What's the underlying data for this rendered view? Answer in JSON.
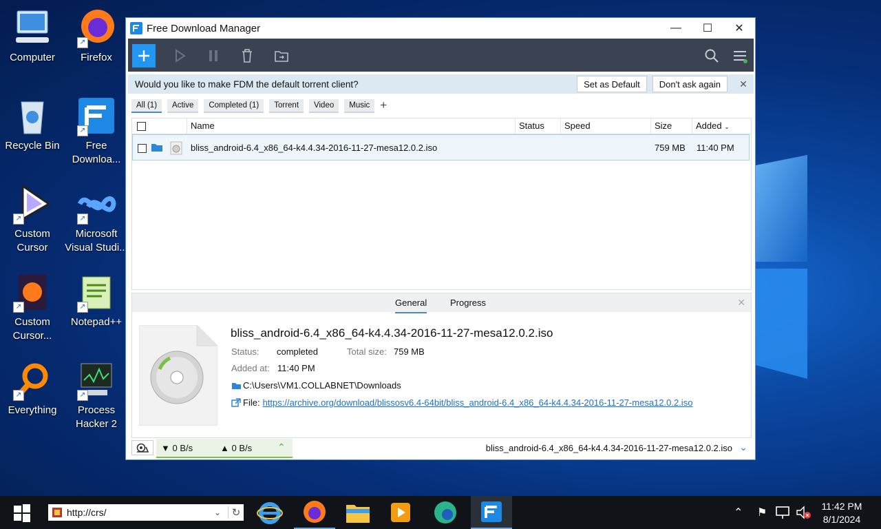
{
  "desktop": {
    "icons": [
      {
        "label": "Computer",
        "icon": "computer-icon"
      },
      {
        "label": "Firefox",
        "icon": "firefox-icon"
      },
      {
        "label": "Recycle Bin",
        "icon": "recycle-bin-icon"
      },
      {
        "label": "Free Downloa...",
        "icon": "fdm-icon"
      },
      {
        "label": "Custom Cursor",
        "icon": "custom-cursor-icon"
      },
      {
        "label": "Microsoft Visual Studi...",
        "icon": "visual-studio-icon"
      },
      {
        "label": "Custom Cursor...",
        "icon": "custom-cursor-firefox-icon"
      },
      {
        "label": "Notepad++",
        "icon": "notepadpp-icon"
      },
      {
        "label": "Everything",
        "icon": "everything-icon"
      },
      {
        "label": "Process Hacker 2",
        "icon": "process-hacker-icon"
      }
    ]
  },
  "window": {
    "title": "Free Download Manager",
    "prompt": {
      "text": "Would you like to make FDM the default torrent client?",
      "set_default": "Set as Default",
      "dont_ask": "Don't ask again"
    },
    "tabs": [
      "All (1)",
      "Active",
      "Completed (1)",
      "Torrent",
      "Video",
      "Music"
    ],
    "columns": {
      "name": "Name",
      "status": "Status",
      "speed": "Speed",
      "size": "Size",
      "added": "Added"
    },
    "row": {
      "name": "bliss_android-6.4_x86_64-k4.4.34-2016-11-27-mesa12.0.2.iso",
      "size": "759 MB",
      "added": "11:40 PM"
    },
    "details": {
      "tab_general": "General",
      "tab_progress": "Progress",
      "filename": "bliss_android-6.4_x86_64-k4.4.34-2016-11-27-mesa12.0.2.iso",
      "status_label": "Status:",
      "status_value": "completed",
      "total_label": "Total size:",
      "total_value": "759 MB",
      "added_label": "Added at:",
      "added_value": "11:40 PM",
      "folder": "C:\\Users\\VM1.COLLABNET\\Downloads",
      "file_label": "File:",
      "file_url": "https://archive.org/download/blissosv6.4-64bit/bliss_android-6.4_x86_64-k4.4.34-2016-11-27-mesa12.0.2.iso"
    },
    "statusbar": {
      "down": "▼ 0 B/s",
      "up": "▲ 0 B/s",
      "current": "bliss_android-6.4_x86_64-k4.4.34-2016-11-27-mesa12.0.2.iso"
    }
  },
  "taskbar": {
    "address": "http://crs/",
    "time": "11:42 PM",
    "date": "8/1/2024"
  }
}
